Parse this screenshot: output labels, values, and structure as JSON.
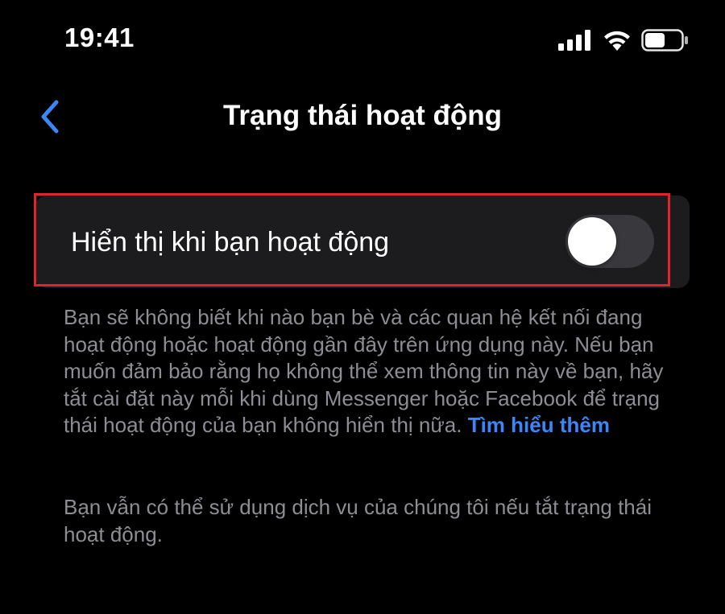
{
  "status_bar": {
    "time": "19:41",
    "icons": [
      "cellular-signal-icon",
      "wifi-icon",
      "battery-icon"
    ]
  },
  "nav": {
    "title": "Trạng thái hoạt động",
    "back_icon": "chevron-left-icon"
  },
  "setting": {
    "label": "Hiển thị khi bạn hoạt động",
    "toggle_on": false
  },
  "description": {
    "text": "Bạn sẽ không biết khi nào bạn bè và các quan hệ kết nối đang hoạt động hoặc hoạt động gần đây trên ứng dụng này. Nếu bạn muốn đảm bảo rằng họ không thể xem thông tin này về bạn, hãy tắt cài đặt này mỗi khi dùng Messenger hoặc Facebook để trạng thái hoạt động của bạn không hiển thị nữa.",
    "link": "Tìm hiểu thêm",
    "note": "Bạn vẫn có thể sử dụng dịch vụ của chúng tôi nếu tắt trạng thái hoạt động."
  },
  "colors": {
    "background": "#000000",
    "card": "#1c1c1e",
    "accent": "#3c86f8",
    "secondary_text": "#8d8d93",
    "toggle_off_track": "#39393d",
    "highlight": "#e0242a"
  }
}
